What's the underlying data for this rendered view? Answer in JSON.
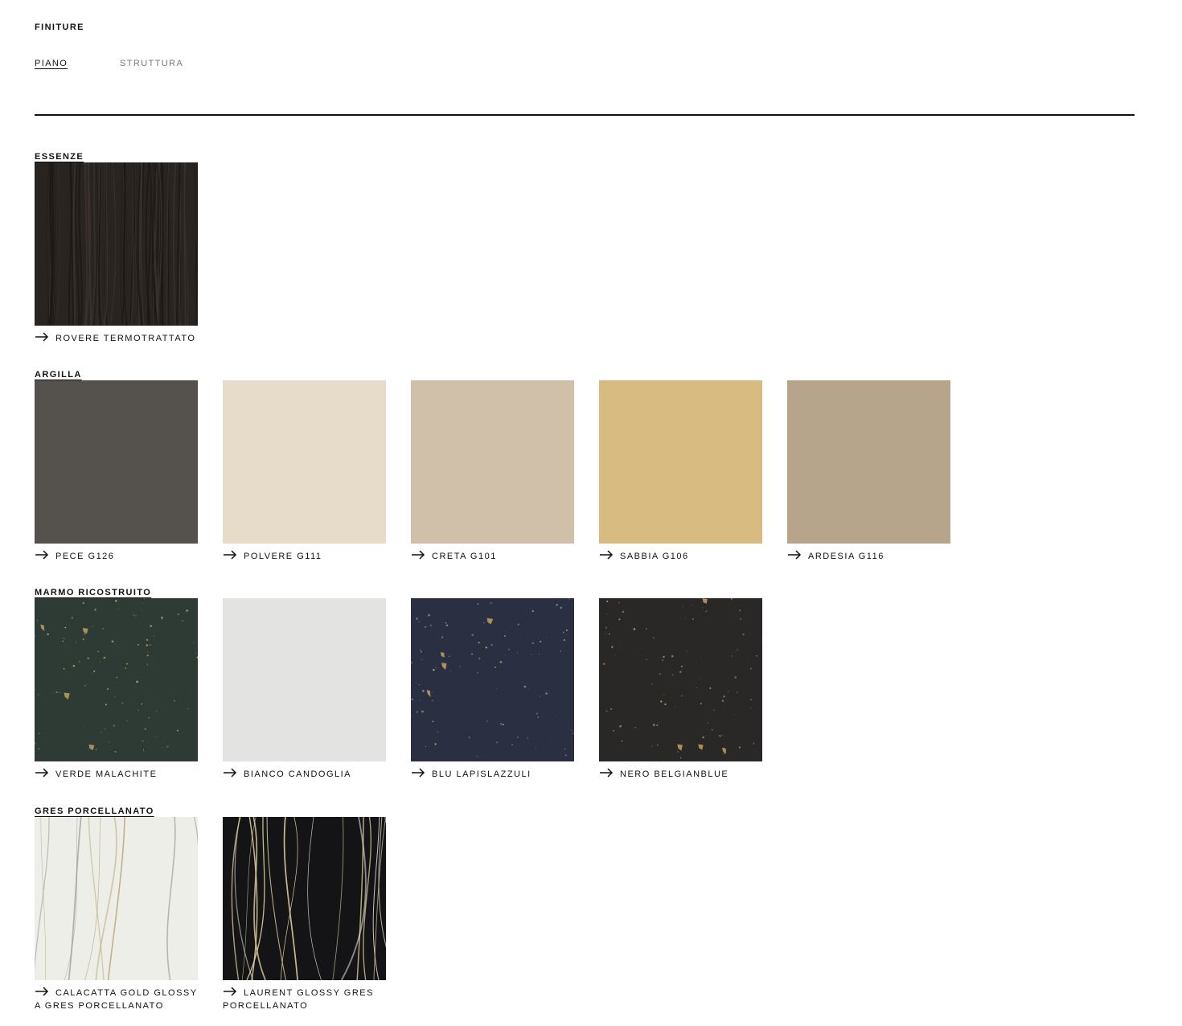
{
  "header": {
    "title": "FINITURE",
    "tabs": [
      {
        "label": "PIANO",
        "active": true
      },
      {
        "label": "STRUTTURA",
        "active": false
      }
    ]
  },
  "sections": [
    {
      "title": "ESSENZE",
      "items": [
        {
          "label": "ROVERE TERMOTRATTATO",
          "pattern": "wood",
          "color": "#2a2420"
        }
      ]
    },
    {
      "title": "ARGILLA",
      "items": [
        {
          "label": "PECE G126",
          "pattern": "plain",
          "color": "#55524d"
        },
        {
          "label": "POLVERE G111",
          "pattern": "plain",
          "color": "#e6dcc9"
        },
        {
          "label": "CRETA G101",
          "pattern": "plain",
          "color": "#d0c0aa"
        },
        {
          "label": "SABBIA G106",
          "pattern": "plain",
          "color": "#d8bb80"
        },
        {
          "label": "ARDESIA G116",
          "pattern": "plain",
          "color": "#b6a58b"
        }
      ]
    },
    {
      "title": "MARMO RICOSTRUITO",
      "items": [
        {
          "label": "VERDE MALACHITE",
          "pattern": "terrazzo",
          "color": "#2d3b34"
        },
        {
          "label": "BIANCO CANDOGLIA",
          "pattern": "plain",
          "color": "#e3e3e1"
        },
        {
          "label": "BLU LAPISLAZZULI",
          "pattern": "terrazzo",
          "color": "#2a2f42"
        },
        {
          "label": "NERO BELGIANBLUE",
          "pattern": "terrazzo",
          "color": "#2a2826"
        }
      ]
    },
    {
      "title": "GRES PORCELLANATO",
      "items": [
        {
          "label": "CALACATTA GOLD GLOSSY A GRES PORCELLANATO",
          "pattern": "marble-light",
          "color": "#eeeee9"
        },
        {
          "label": "LAURENT GLOSSY GRES PORCELLANATO",
          "pattern": "marble-dark",
          "color": "#141416"
        }
      ]
    }
  ]
}
